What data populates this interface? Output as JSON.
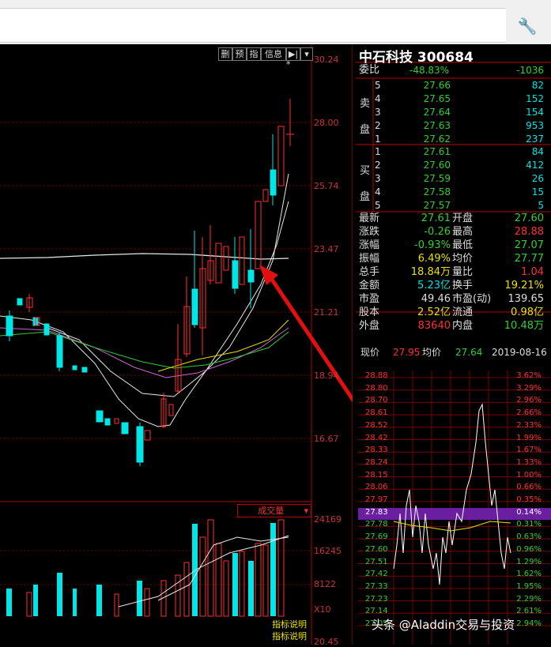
{
  "toolbar": {
    "buttons": [
      "删",
      "预",
      "指",
      "信息",
      "▶|",
      "▾"
    ]
  },
  "main_chart": {
    "price_axis": [
      "30.24",
      "28.00",
      "25.74",
      "23.47",
      "21.21",
      "18.94",
      "16.67"
    ],
    "star_mark": "*",
    "volume_button": "成交量",
    "volume_axis": [
      "24169",
      "16245",
      "8122",
      "X10"
    ],
    "indicator_notes": [
      "指标说明",
      "指标说明"
    ],
    "bottom_partial": "20.45"
  },
  "stock": {
    "name_code": "中石科技 300684",
    "weibi_label": "委比",
    "weibi_value": "-48.83%",
    "weicha_value": "-1036",
    "sell_group": "卖盘",
    "buy_group": "买盘",
    "sell": [
      {
        "lvl": "5",
        "price": "27.66",
        "vol": "82"
      },
      {
        "lvl": "4",
        "price": "27.65",
        "vol": "152"
      },
      {
        "lvl": "3",
        "price": "27.64",
        "vol": "154"
      },
      {
        "lvl": "2",
        "price": "27.63",
        "vol": "953"
      },
      {
        "lvl": "1",
        "price": "27.62",
        "vol": "237"
      }
    ],
    "buy": [
      {
        "lvl": "1",
        "price": "27.61",
        "vol": "84"
      },
      {
        "lvl": "2",
        "price": "27.60",
        "vol": "412"
      },
      {
        "lvl": "3",
        "price": "27.59",
        "vol": "26"
      },
      {
        "lvl": "4",
        "price": "27.58",
        "vol": "15"
      },
      {
        "lvl": "5",
        "price": "27.57",
        "vol": "5"
      }
    ],
    "stats": [
      {
        "l1": "最新",
        "v1": "27.61",
        "c1": "g",
        "l2": "开盘",
        "v2": "27.60",
        "c2": "g"
      },
      {
        "l1": "涨跌",
        "v1": "-0.26",
        "c1": "g",
        "l2": "最高",
        "v2": "28.88",
        "c2": "r"
      },
      {
        "l1": "涨幅",
        "v1": "-0.93%",
        "c1": "g",
        "l2": "最低",
        "v2": "27.07",
        "c2": "g"
      },
      {
        "l1": "振幅",
        "v1": "6.49%",
        "c1": "y",
        "l2": "均价",
        "v2": "27.77",
        "c2": "g"
      },
      {
        "l1": "总手",
        "v1": "18.84万",
        "c1": "y",
        "l2": "量比",
        "v2": "1.04",
        "c2": "r"
      },
      {
        "l1": "金额",
        "v1": "5.23亿",
        "c1": "c",
        "l2": "换手",
        "v2": "19.21%",
        "c2": "y"
      },
      {
        "l1": "市盈",
        "v1": "49.46",
        "c1": "w",
        "l2": "市盈(动)",
        "v2": "139.65",
        "c2": "w"
      },
      {
        "l1": "股本",
        "v1": "2.52亿",
        "c1": "y",
        "l2": "流通",
        "v2": "0.98亿",
        "c2": "y"
      },
      {
        "l1": "外盘",
        "v1": "83640",
        "c1": "r",
        "l2": "内盘",
        "v2": "10.48万",
        "c2": "g"
      }
    ]
  },
  "intraday": {
    "now_label": "现价",
    "now_value": "27.95",
    "avg_label": "均价",
    "avg_value": "27.64",
    "date": "2019-08-16",
    "left_axis": [
      "28.88",
      "28.80",
      "28.70",
      "28.61",
      "28.52",
      "28.42",
      "28.33",
      "28.24",
      "28.15",
      "28.06",
      "27.97",
      "27.83",
      "27.78",
      "27.69",
      "27.60",
      "27.51",
      "27.42",
      "27.33",
      "27.23",
      "27.14",
      "27.05"
    ],
    "right_axis": [
      "3.62%",
      "3.29%",
      "2.96%",
      "2.66%",
      "2.33%",
      "1.99%",
      "1.67%",
      "1.33%",
      "1.00%",
      "0.66%",
      "0.35%",
      "0.14%",
      "0.31%",
      "0.63%",
      "0.96%",
      "1.29%",
      "1.62%",
      "1.95%",
      "2.29%",
      "2.61%",
      "2.94%"
    ],
    "highlight": "27.83",
    "highlight_pct": "0.14%"
  },
  "watermark": "头条 @Aladdin交易与投资"
}
